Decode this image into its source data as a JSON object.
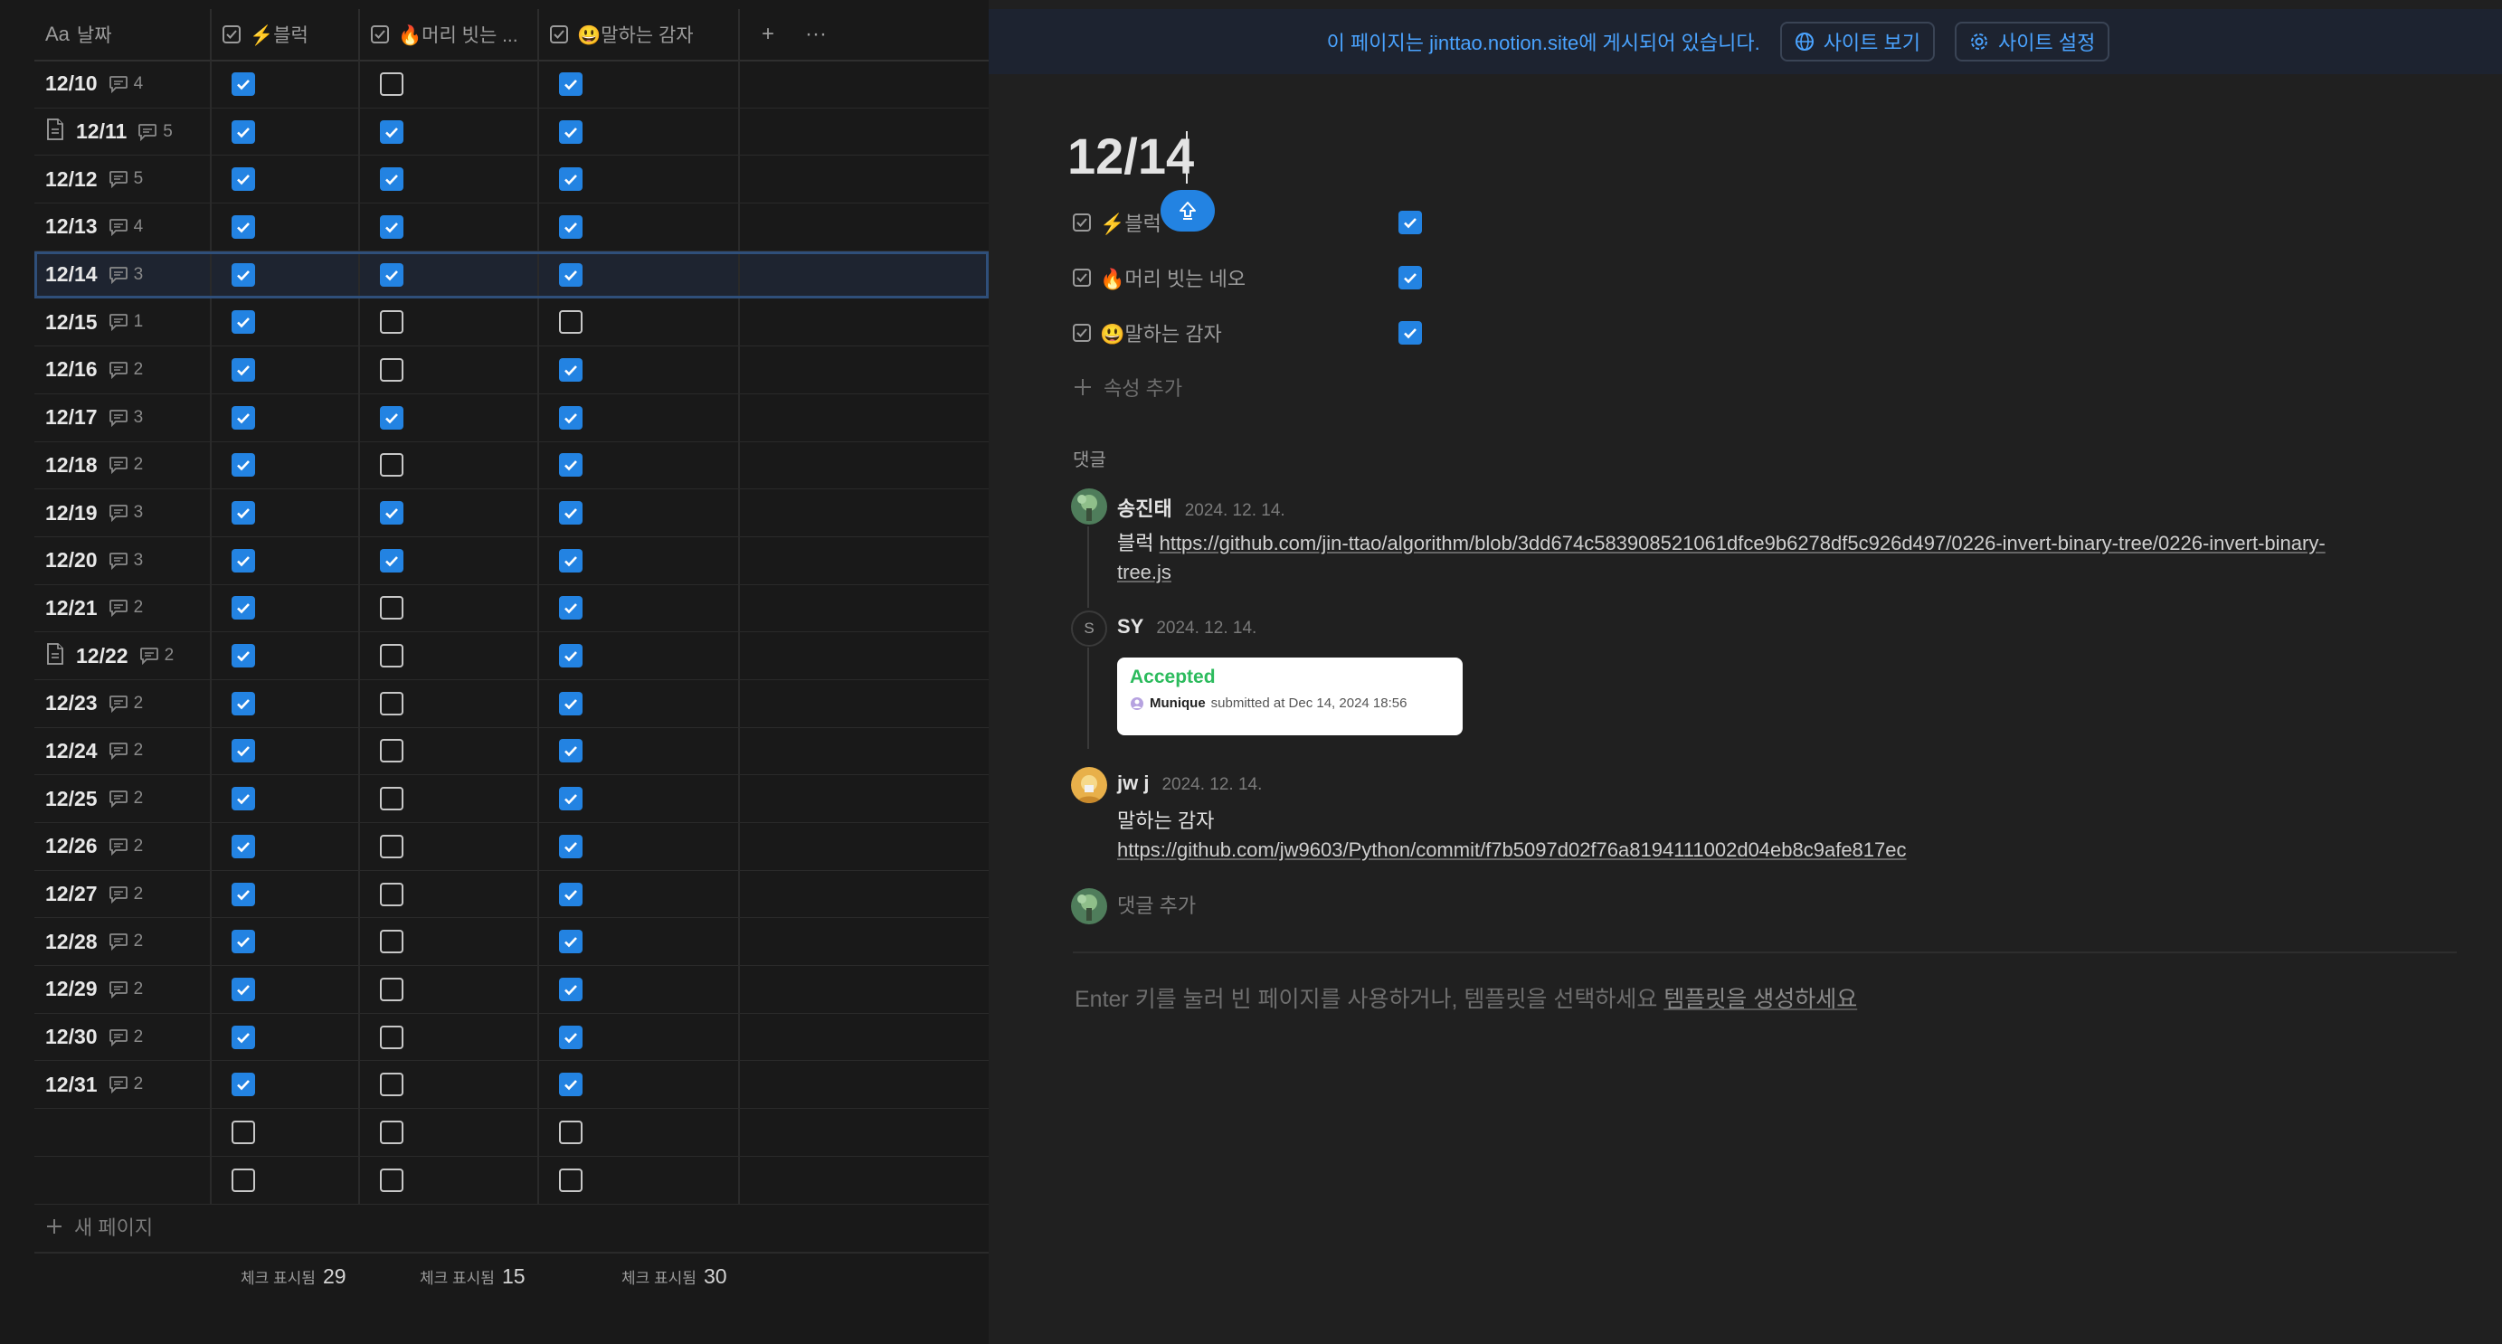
{
  "table": {
    "headers": {
      "date": "날짜",
      "date_icon": "Aa",
      "col1": "⚡블럭",
      "col2": "🔥머리 빗는 ...",
      "col3": "😃말하는 감자",
      "add": "+",
      "more": "···"
    },
    "rows": [
      {
        "date": "12/10",
        "comments": "4",
        "doc": false,
        "c1": true,
        "c2": false,
        "c3": true
      },
      {
        "date": "12/11",
        "comments": "5",
        "doc": true,
        "c1": true,
        "c2": true,
        "c3": true
      },
      {
        "date": "12/12",
        "comments": "5",
        "doc": false,
        "c1": true,
        "c2": true,
        "c3": true
      },
      {
        "date": "12/13",
        "comments": "4",
        "doc": false,
        "c1": true,
        "c2": true,
        "c3": true
      },
      {
        "date": "12/14",
        "comments": "3",
        "doc": false,
        "c1": true,
        "c2": true,
        "c3": true,
        "selected": true
      },
      {
        "date": "12/15",
        "comments": "1",
        "doc": false,
        "c1": true,
        "c2": false,
        "c3": false
      },
      {
        "date": "12/16",
        "comments": "2",
        "doc": false,
        "c1": true,
        "c2": false,
        "c3": true
      },
      {
        "date": "12/17",
        "comments": "3",
        "doc": false,
        "c1": true,
        "c2": true,
        "c3": true
      },
      {
        "date": "12/18",
        "comments": "2",
        "doc": false,
        "c1": true,
        "c2": false,
        "c3": true
      },
      {
        "date": "12/19",
        "comments": "3",
        "doc": false,
        "c1": true,
        "c2": true,
        "c3": true
      },
      {
        "date": "12/20",
        "comments": "3",
        "doc": false,
        "c1": true,
        "c2": true,
        "c3": true
      },
      {
        "date": "12/21",
        "comments": "2",
        "doc": false,
        "c1": true,
        "c2": false,
        "c3": true
      },
      {
        "date": "12/22",
        "comments": "2",
        "doc": true,
        "c1": true,
        "c2": false,
        "c3": true
      },
      {
        "date": "12/23",
        "comments": "2",
        "doc": false,
        "c1": true,
        "c2": false,
        "c3": true
      },
      {
        "date": "12/24",
        "comments": "2",
        "doc": false,
        "c1": true,
        "c2": false,
        "c3": true
      },
      {
        "date": "12/25",
        "comments": "2",
        "doc": false,
        "c1": true,
        "c2": false,
        "c3": true
      },
      {
        "date": "12/26",
        "comments": "2",
        "doc": false,
        "c1": true,
        "c2": false,
        "c3": true
      },
      {
        "date": "12/27",
        "comments": "2",
        "doc": false,
        "c1": true,
        "c2": false,
        "c3": true
      },
      {
        "date": "12/28",
        "comments": "2",
        "doc": false,
        "c1": true,
        "c2": false,
        "c3": true
      },
      {
        "date": "12/29",
        "comments": "2",
        "doc": false,
        "c1": true,
        "c2": false,
        "c3": true
      },
      {
        "date": "12/30",
        "comments": "2",
        "doc": false,
        "c1": true,
        "c2": false,
        "c3": true
      },
      {
        "date": "12/31",
        "comments": "2",
        "doc": false,
        "c1": true,
        "c2": false,
        "c3": true
      },
      {
        "date": "",
        "comments": "",
        "doc": false,
        "c1": false,
        "c2": false,
        "c3": false
      },
      {
        "date": "",
        "comments": "",
        "doc": false,
        "c1": false,
        "c2": false,
        "c3": false
      }
    ],
    "new_page": "새 페이지",
    "footer": [
      {
        "label": "체크 표시됨",
        "value": "29"
      },
      {
        "label": "체크 표시됨",
        "value": "15"
      },
      {
        "label": "체크 표시됨",
        "value": "30"
      }
    ]
  },
  "peek": {
    "banner": {
      "text": "이 페이지는 jinttao.notion.site에 게시되어 있습니다.",
      "view_site": "사이트 보기",
      "site_settings": "사이트 설정"
    },
    "title": "12/14",
    "properties": [
      {
        "label": "⚡블럭",
        "checked": true
      },
      {
        "label": "🔥머리 빗는 네오",
        "checked": true
      },
      {
        "label": "😃말하는 감자",
        "checked": true
      }
    ],
    "add_property": "속성 추가",
    "comments_label": "댓글",
    "comments": [
      {
        "author": "송진태",
        "date": "2024. 12. 14.",
        "prefix": "블럭 ",
        "link": "https://github.com/jin-ttao/algorithm/blob/3dd674c583908521061dfce9b6278df5c926d497/0226-invert-binary-tree/0226-invert-binary-",
        "link2": "tree.js"
      },
      {
        "author": "SY",
        "avatar_letter": "S",
        "date": "2024. 12. 14.",
        "card": {
          "title": "Accepted",
          "user": "Munique",
          "text": "submitted at Dec 14, 2024 18:56"
        }
      },
      {
        "author": "jw j",
        "date": "2024. 12. 14.",
        "line1": "말하는 감자",
        "link": "https://github.com/jw9603/Python/commit/f7b5097d02f76a8194111002d04eb8c9afe817ec"
      }
    ],
    "add_comment": "댓글 추가",
    "empty_hint": "Enter 키를 눌러 빈 페이지를 사용하거나, 템플릿을 선택하세요",
    "create_template": "템플릿을 생성하세요"
  },
  "colors": {
    "accent": "#2383e2",
    "banner_text": "#4aa3ff",
    "background": "#191919",
    "peek_background": "#202020",
    "accepted_green": "#2cbb5d"
  }
}
